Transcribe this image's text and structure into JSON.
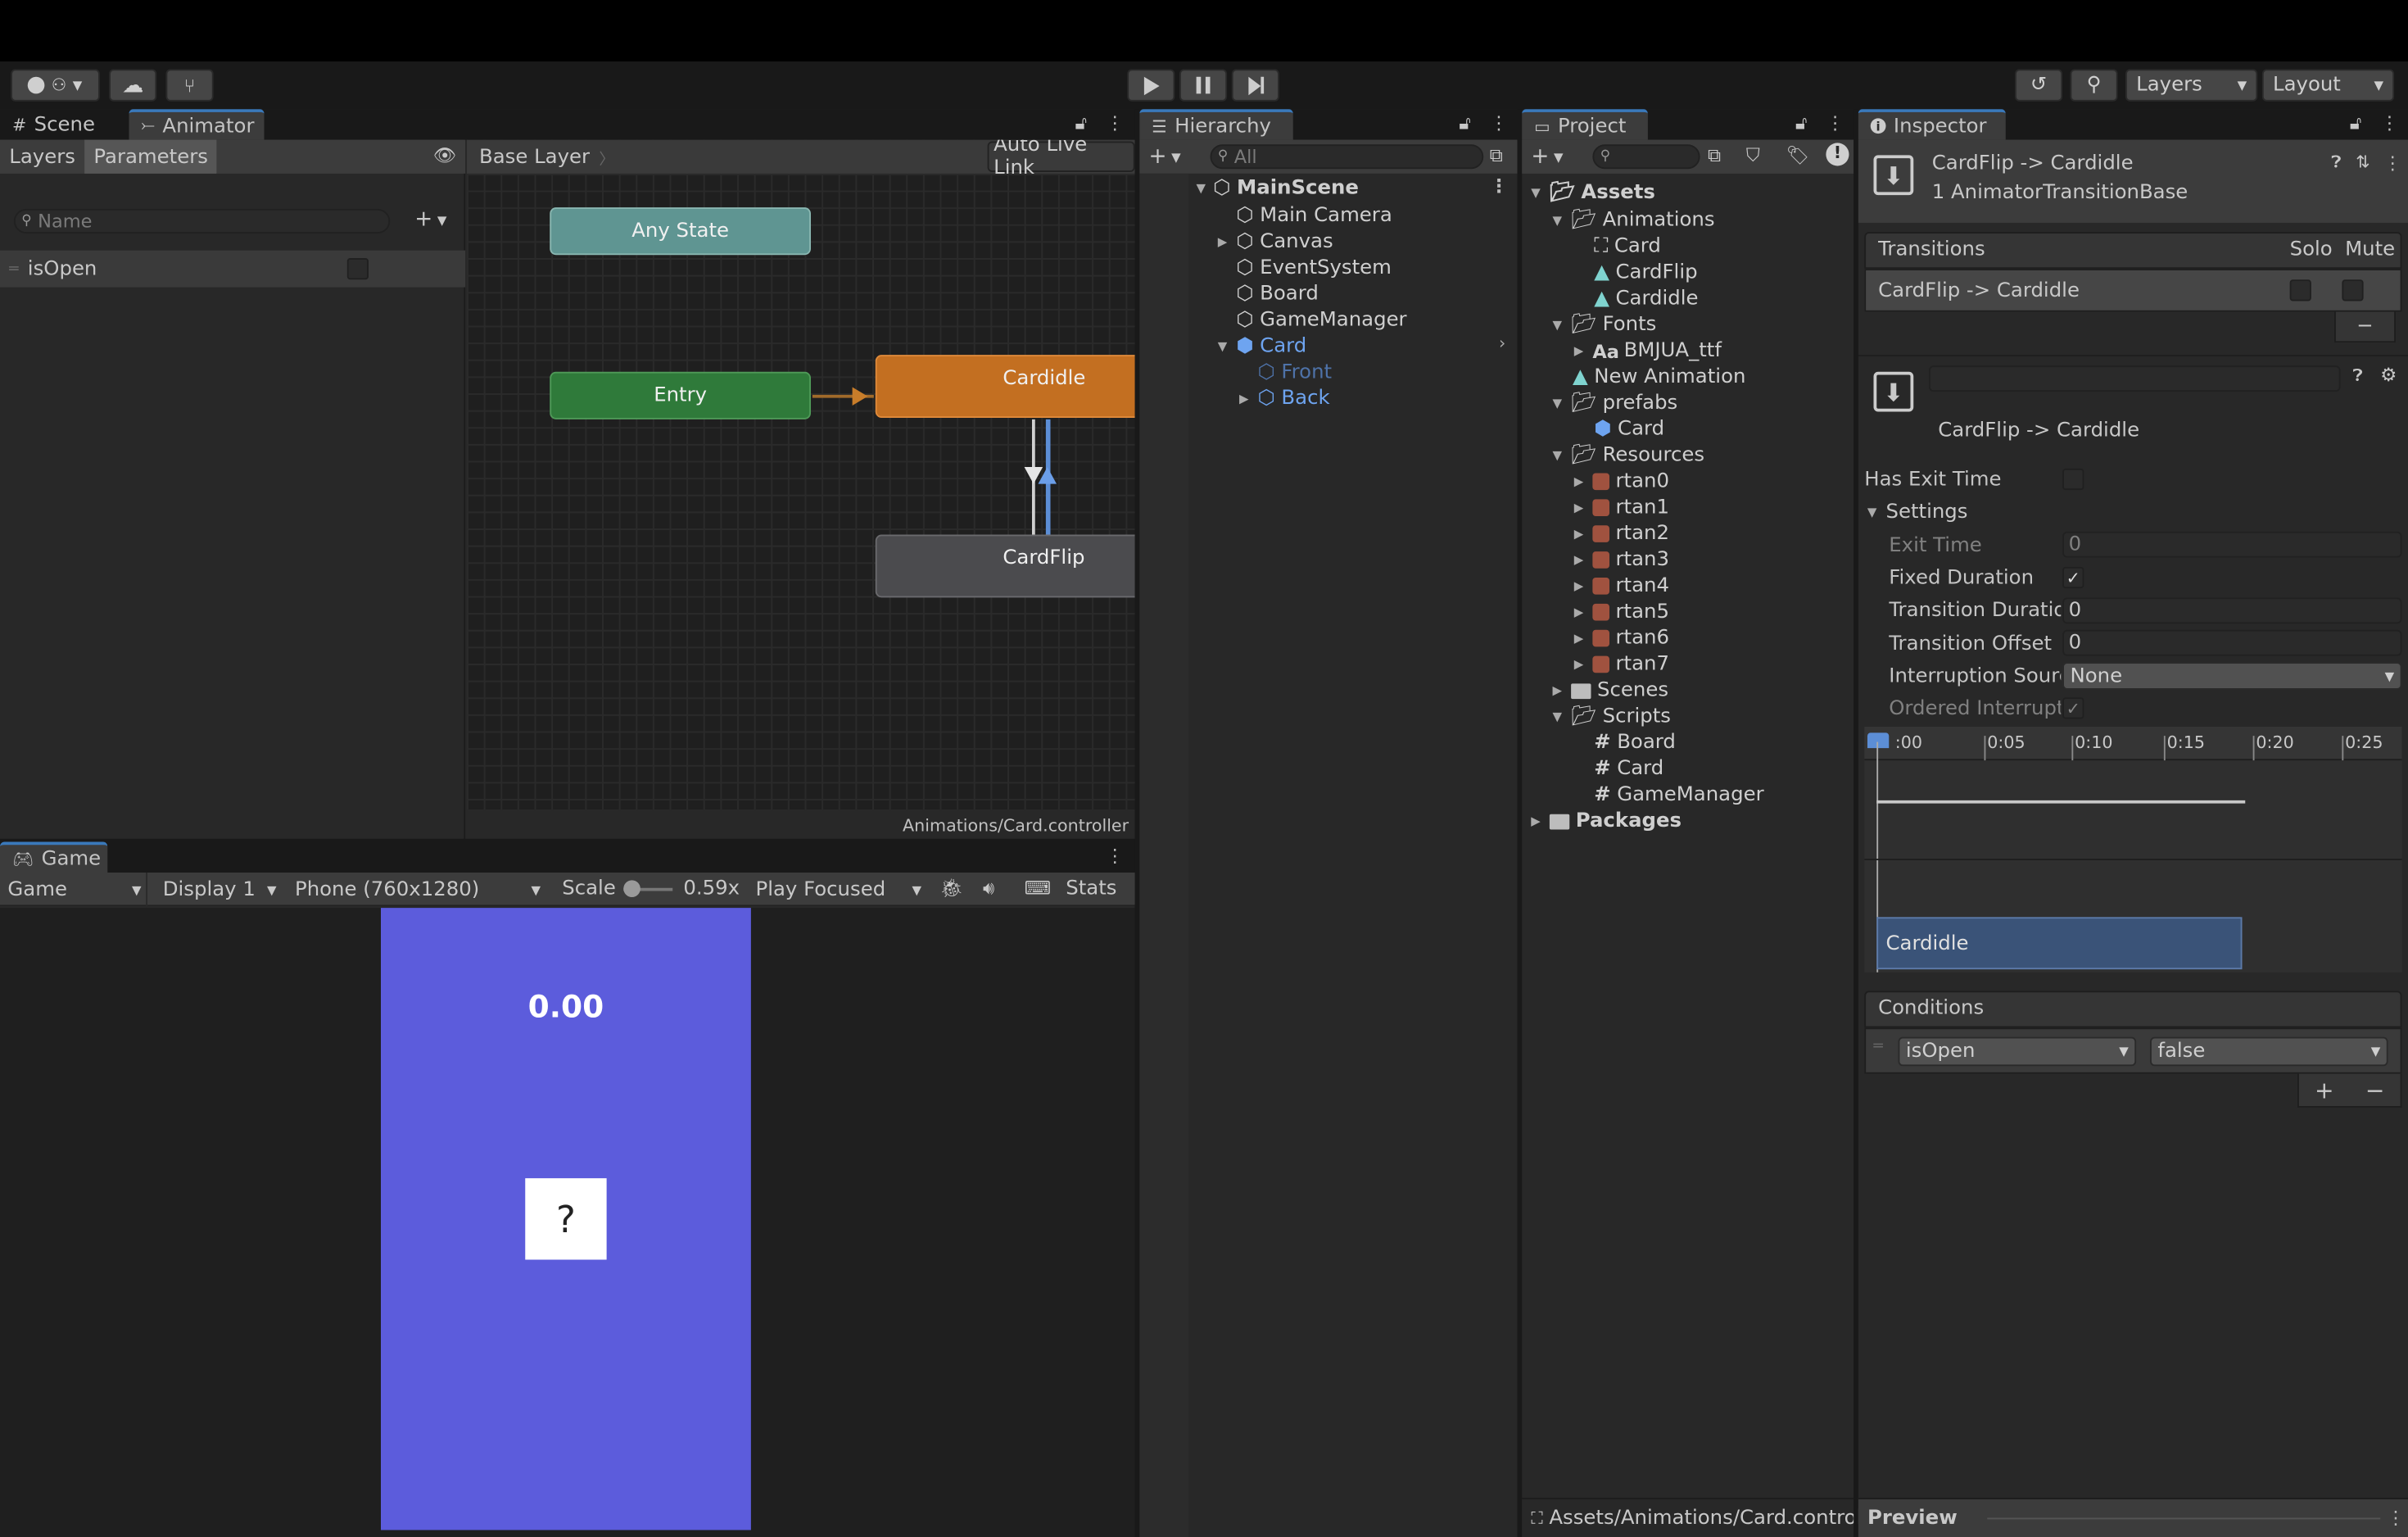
{
  "toolbar": {
    "play_icon": "play-icon",
    "pause_icon": "pause-icon",
    "step_icon": "step-icon",
    "layers_label": "Layers",
    "layout_label": "Layout"
  },
  "animator": {
    "tabs": [
      "Scene",
      "Animator"
    ],
    "subtabs": [
      "Layers",
      "Parameters"
    ],
    "search_placeholder": "Name",
    "parameter_name": "isOpen",
    "breadcrumb": "Base Layer",
    "auto_live_link": "Auto Live Link",
    "nodes": {
      "any_state": "Any State",
      "entry": "Entry",
      "cardidle": "Cardidle",
      "cardflip": "CardFlip"
    },
    "footer_path": "Animations/Card.controller",
    "colors": {
      "any_state": "#5f9592",
      "entry": "#2f7a3a",
      "cardidle": "#c36f21",
      "cardflip": "#4b4b4e"
    }
  },
  "game": {
    "tab": "Game",
    "mode": "Game",
    "display": "Display 1",
    "resolution": "Phone (760x1280)",
    "scale_label": "Scale",
    "scale_value": "0.59x",
    "play_focused": "Play Focused",
    "stats": "Stats",
    "score": "0.00",
    "card_symbol": "?",
    "bg_color": "#5c5cdc"
  },
  "hierarchy": {
    "tab": "Hierarchy",
    "search_placeholder": "All",
    "scene": "MainScene",
    "items": [
      "Main Camera",
      "Canvas",
      "EventSystem",
      "Board",
      "GameManager",
      "Card",
      "Front",
      "Back"
    ]
  },
  "project": {
    "tab": "Project",
    "assets": "Assets",
    "animations": "Animations",
    "anim_items": [
      "Card",
      "CardFlip",
      "Cardidle"
    ],
    "fonts": "Fonts",
    "font_items": [
      "BMJUA_ttf",
      "New Animation"
    ],
    "font_prefix": "Aa",
    "prefabs": "prefabs",
    "prefab_items": [
      "Card"
    ],
    "resources": "Resources",
    "resource_items": [
      "rtan0",
      "rtan1",
      "rtan2",
      "rtan3",
      "rtan4",
      "rtan5",
      "rtan6",
      "rtan7"
    ],
    "scenes": "Scenes",
    "scripts": "Scripts",
    "script_items": [
      "Board",
      "Card",
      "GameManager"
    ],
    "packages": "Packages",
    "footer_path": "Assets/Animations/Card.control"
  },
  "inspector": {
    "tab": "Inspector",
    "title": "CardFlip -> Cardidle",
    "subtitle": "1 AnimatorTransitionBase",
    "transitions_header": "Transitions",
    "solo": "Solo",
    "mute": "Mute",
    "transition_row": "CardFlip -> Cardidle",
    "minus": "−",
    "transition_name": "CardFlip -> Cardidle",
    "has_exit_time": "Has Exit Time",
    "settings": "Settings",
    "exit_time_label": "Exit Time",
    "exit_time_value": "0",
    "fixed_duration_label": "Fixed Duration",
    "transition_duration_label": "Transition Duratior",
    "transition_duration_value": "0",
    "transition_offset_label": "Transition Offset",
    "transition_offset_value": "0",
    "interruption_source_label": "Interruption Source",
    "interruption_source_value": "None",
    "ordered_interruption_label": "Ordered Interruptio",
    "timeline_ticks": [
      ":00",
      "0:05",
      "0:10",
      "0:15",
      "0:20",
      "0:25"
    ],
    "timeline_clip": "Cardidle",
    "conditions_header": "Conditions",
    "condition_param": "isOpen",
    "condition_value": "false",
    "plus": "+",
    "preview": "Preview"
  }
}
